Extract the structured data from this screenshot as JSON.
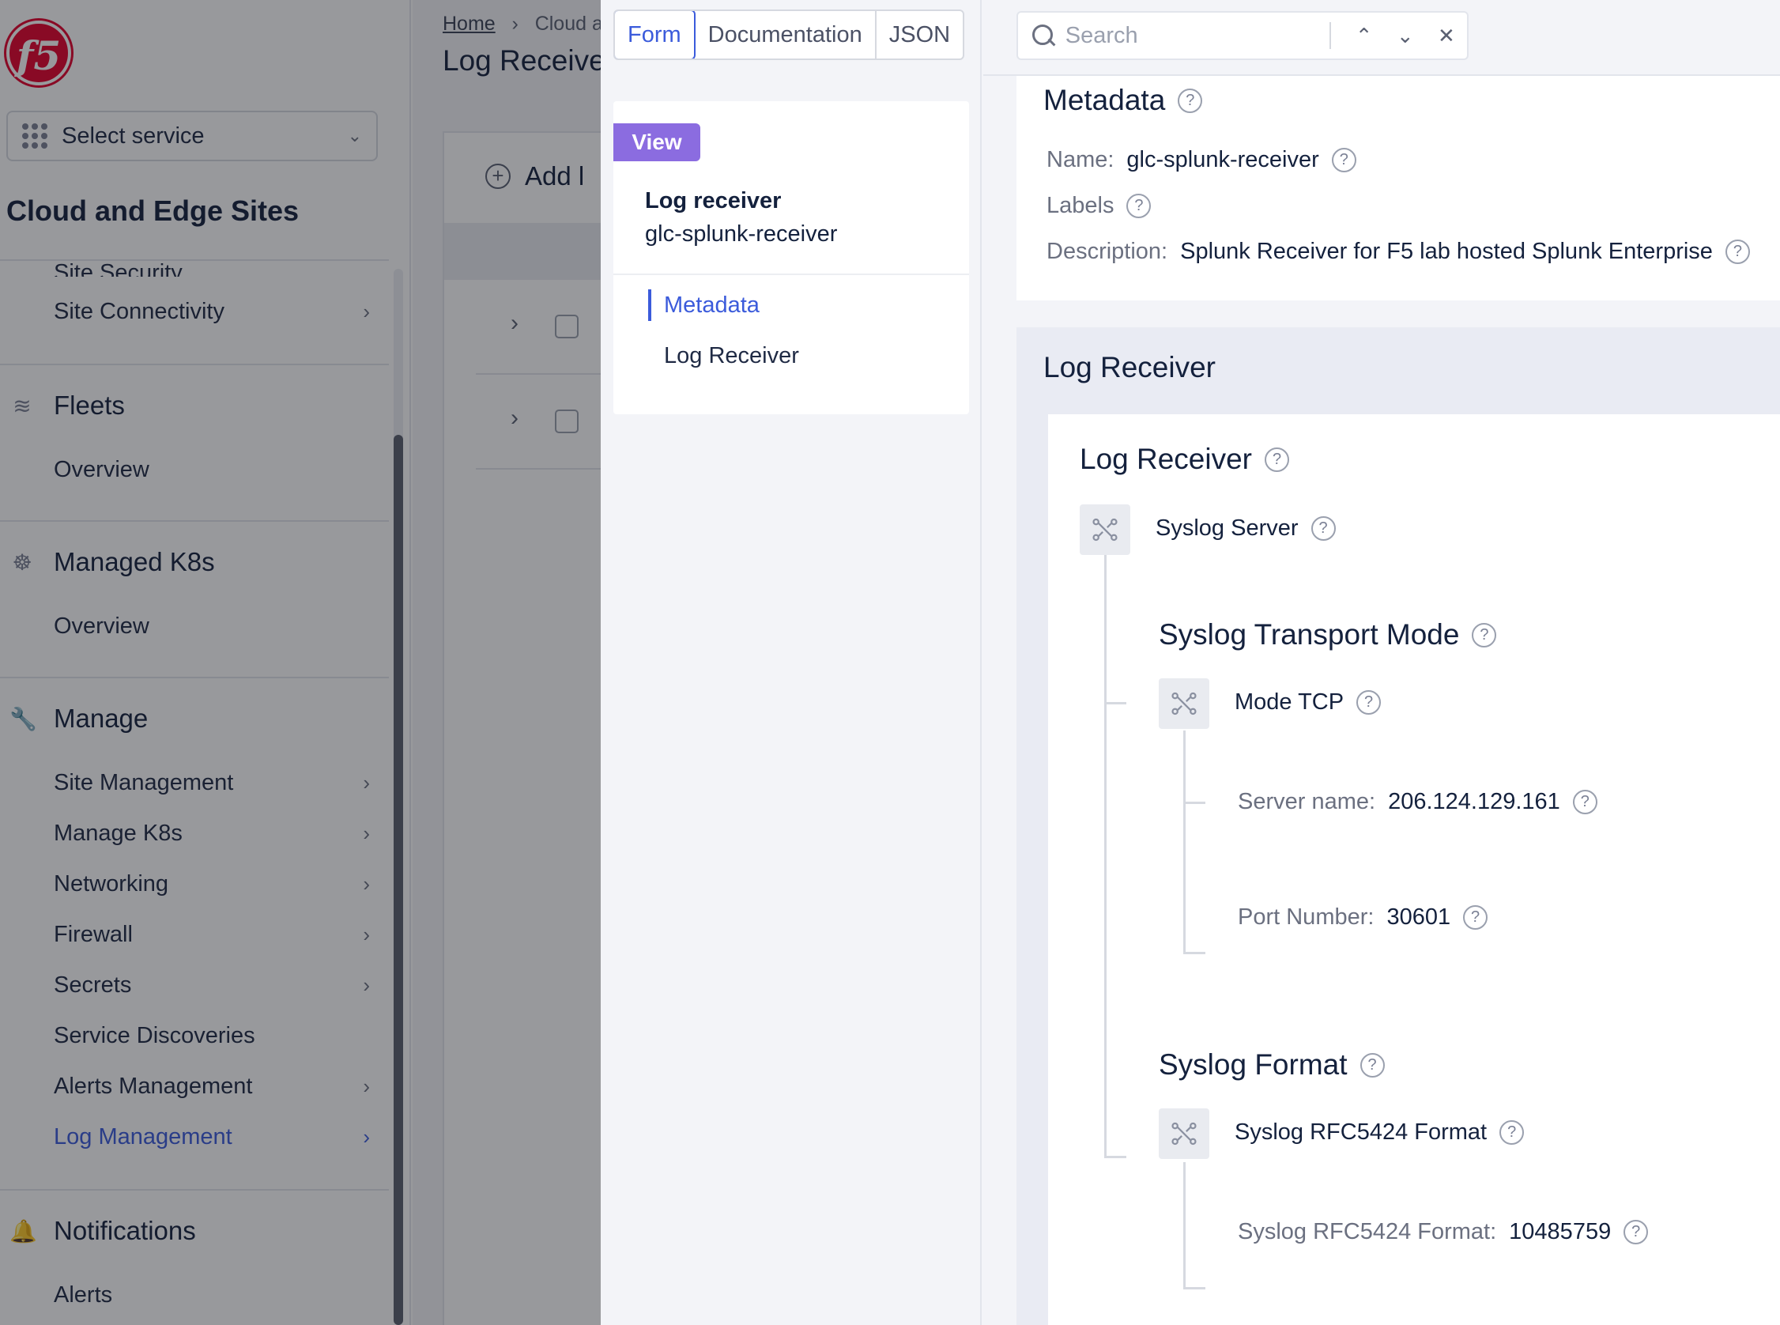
{
  "sidebar": {
    "logo_text": "f5",
    "service_select": "Select service",
    "title": "Cloud and Edge Sites",
    "items": [
      {
        "label": "Site Security"
      },
      {
        "label": "Site Connectivity"
      }
    ],
    "fleets": {
      "label": "Fleets",
      "items": [
        {
          "label": "Overview"
        }
      ]
    },
    "managed_k8s": {
      "label": "Managed K8s",
      "items": [
        {
          "label": "Overview"
        }
      ]
    },
    "manage": {
      "label": "Manage",
      "items": [
        {
          "label": "Site Management"
        },
        {
          "label": "Manage K8s"
        },
        {
          "label": "Networking"
        },
        {
          "label": "Firewall"
        },
        {
          "label": "Secrets"
        },
        {
          "label": "Service Discoveries"
        },
        {
          "label": "Alerts Management"
        },
        {
          "label": "Log Management"
        }
      ]
    },
    "notifications": {
      "label": "Notifications",
      "items": [
        {
          "label": "Alerts"
        }
      ]
    },
    "active_color": "#3b5bdb"
  },
  "main": {
    "breadcrumb_home": "Home",
    "breadcrumb_next": "Cloud a",
    "title": "Log Receive",
    "add_button": "Add l"
  },
  "drawer": {
    "tabs": [
      {
        "label": "Form"
      },
      {
        "label": "Documentation"
      },
      {
        "label": "JSON"
      }
    ],
    "view_badge": "View",
    "object_type": "Log receiver",
    "object_name": "glc-splunk-receiver",
    "nav_links": [
      {
        "label": "Metadata"
      },
      {
        "label": "Log Receiver"
      }
    ],
    "search_placeholder": "Search",
    "metadata": {
      "title": "Metadata",
      "name_label": "Name:",
      "name_value": "glc-splunk-receiver",
      "labels_label": "Labels",
      "description_label": "Description:",
      "description_value": "Splunk Receiver for F5 lab hosted Splunk Enterprise"
    },
    "log_receiver": {
      "section_title": "Log Receiver",
      "card_title": "Log Receiver",
      "syslog_server": "Syslog Server",
      "transport_title": "Syslog Transport Mode",
      "mode": "Mode TCP",
      "server_name_label": "Server name:",
      "server_name_value": "206.124.129.161",
      "port_label": "Port Number:",
      "port_value": "30601",
      "format_title": "Syslog Format",
      "format": "Syslog RFC5424 Format",
      "format_field_label": "Syslog RFC5424 Format:",
      "format_field_value": "10485759"
    },
    "accent_color": "#3b5bdb",
    "badge_color": "#8b6ce0"
  }
}
